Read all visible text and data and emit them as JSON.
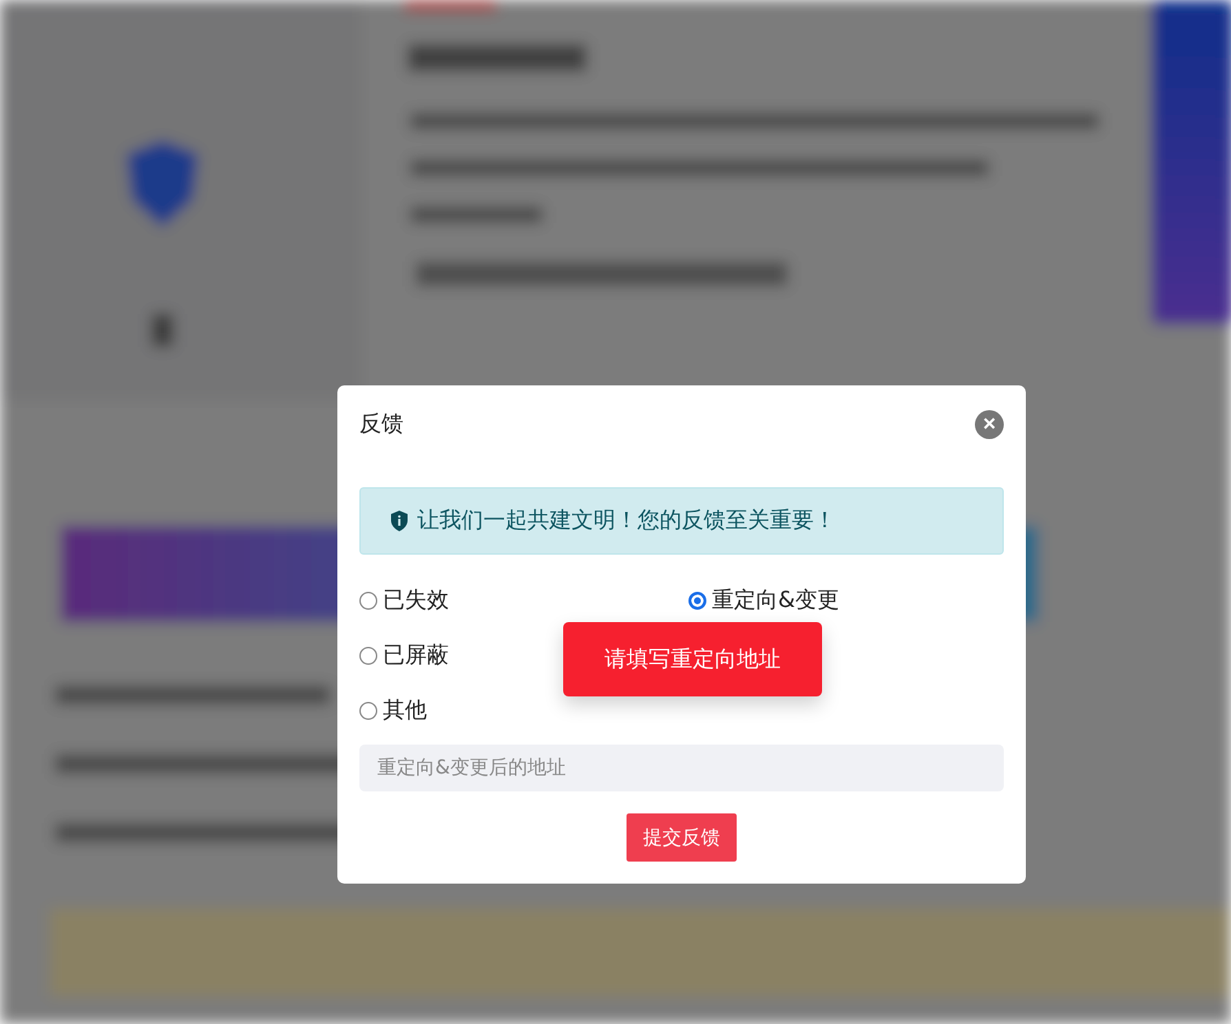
{
  "dialog": {
    "title": "反馈",
    "close": "×",
    "notice": "让我们一起共建文明！您的反馈至关重要！",
    "options": [
      {
        "label": "已失效",
        "selected": false
      },
      {
        "label": "重定向&变更",
        "selected": true
      },
      {
        "label": "已屏蔽",
        "selected": false
      },
      {
        "label": "其他",
        "selected": false
      }
    ],
    "address_field": {
      "placeholder": "重定向&变更后的地址"
    },
    "submit": "提交反馈"
  },
  "toast": "请填写重定向地址"
}
